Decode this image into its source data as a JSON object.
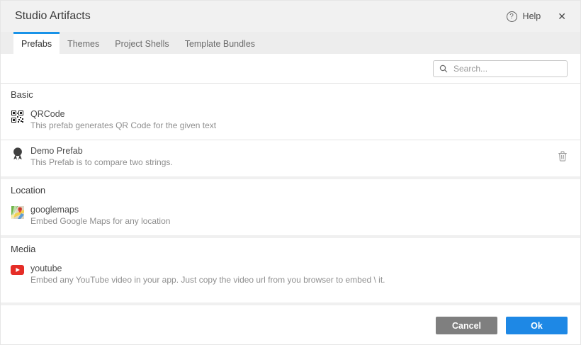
{
  "dialog": {
    "title": "Studio Artifacts",
    "help_label": "Help",
    "close_glyph": "✕",
    "help_glyph": "?"
  },
  "tabs": [
    {
      "label": "Prefabs",
      "active": true
    },
    {
      "label": "Themes",
      "active": false
    },
    {
      "label": "Project Shells",
      "active": false
    },
    {
      "label": "Template Bundles",
      "active": false
    }
  ],
  "search": {
    "placeholder": "Search...",
    "value": "",
    "icon": "search-icon"
  },
  "sections": [
    {
      "name": "Basic",
      "items": [
        {
          "icon": "qrcode-icon",
          "title": "QRCode",
          "description": "This prefab generates QR Code for the given text"
        },
        {
          "icon": "ribbon-icon",
          "title": "Demo Prefab",
          "description": "This Prefab is to compare two strings.",
          "delete_icon": "trash-icon"
        }
      ]
    },
    {
      "name": "Location",
      "items": [
        {
          "icon": "googlemaps-icon",
          "title": "googlemaps",
          "description": "Embed Google Maps for any location"
        }
      ]
    },
    {
      "name": "Media",
      "items": [
        {
          "icon": "youtube-icon",
          "title": "youtube",
          "description": "Embed any YouTube video in your app. Just copy the video url from you browser to embed \\ it."
        }
      ]
    }
  ],
  "footer": {
    "cancel_label": "Cancel",
    "ok_label": "Ok"
  },
  "colors": {
    "accent": "#1993e8",
    "ok_button": "#1e88e5",
    "cancel_button": "#7f7f7f",
    "youtube_red": "#e52d27"
  }
}
